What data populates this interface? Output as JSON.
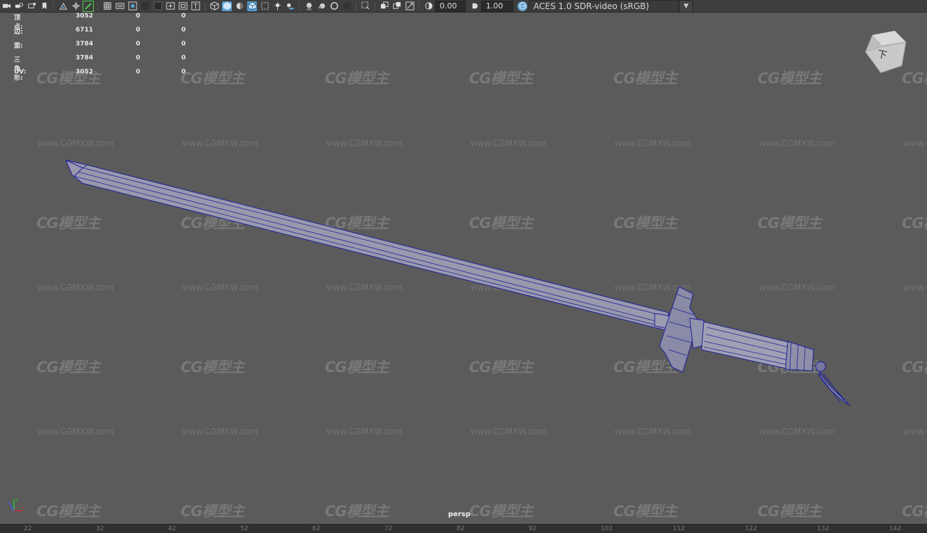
{
  "toolbar": {
    "icons": [
      "camera-icon",
      "camera-attributes-icon",
      "bookmark-icon",
      "image-plane-icon",
      "grid-cross-icon",
      "film-gate-icon",
      "resolution-gate-icon",
      "safe-area-icon",
      "field-chart-icon",
      "wireframe-icon",
      "smooth-shade-icon",
      "default-material-icon",
      "wireframe-on-shaded-icon",
      "textured-icon",
      "use-all-lights-icon",
      "shadows-icon",
      "ambient-occlusion-icon",
      "motion-blur-icon",
      "anti-aliasing-icon",
      "depth-of-field-icon",
      "isolate-select-icon",
      "xray-icon",
      "xray-joints-icon",
      "backface-culling-icon",
      "exposure-icon",
      "gamma-icon",
      "color-management-icon"
    ],
    "exposure_value": "0.00",
    "gamma_value": "1.00",
    "colorspace": "ACES 1.0 SDR-video (sRGB)",
    "active_color": "#5a9fcf",
    "highlight_color": "#4fd04f"
  },
  "hud": {
    "rows": [
      {
        "label": "顶点:",
        "v1": "3052",
        "v2": "0",
        "v3": "0"
      },
      {
        "label": "边:",
        "v1": "6711",
        "v2": "0",
        "v3": "0"
      },
      {
        "label": "面:",
        "v1": "3784",
        "v2": "0",
        "v3": "0"
      },
      {
        "label": "三角形:",
        "v1": "3784",
        "v2": "0",
        "v3": "0"
      },
      {
        "label": "UV:",
        "v1": "3052",
        "v2": "0",
        "v3": "0"
      }
    ]
  },
  "watermark": {
    "logo": "CG模型主",
    "url": "www.CGMXW.com"
  },
  "viewcube": {
    "label": "下"
  },
  "viewport": {
    "camera": "persp",
    "background": "#5b5b5b",
    "wire_color": "#1f1f9a"
  },
  "axis": {
    "x": "x",
    "y": "y",
    "z": "z"
  },
  "ruler": {
    "numbers": [
      "22",
      "32",
      "42",
      "52",
      "62",
      "72",
      "82",
      "92",
      "102",
      "112",
      "122",
      "132",
      "142"
    ]
  }
}
